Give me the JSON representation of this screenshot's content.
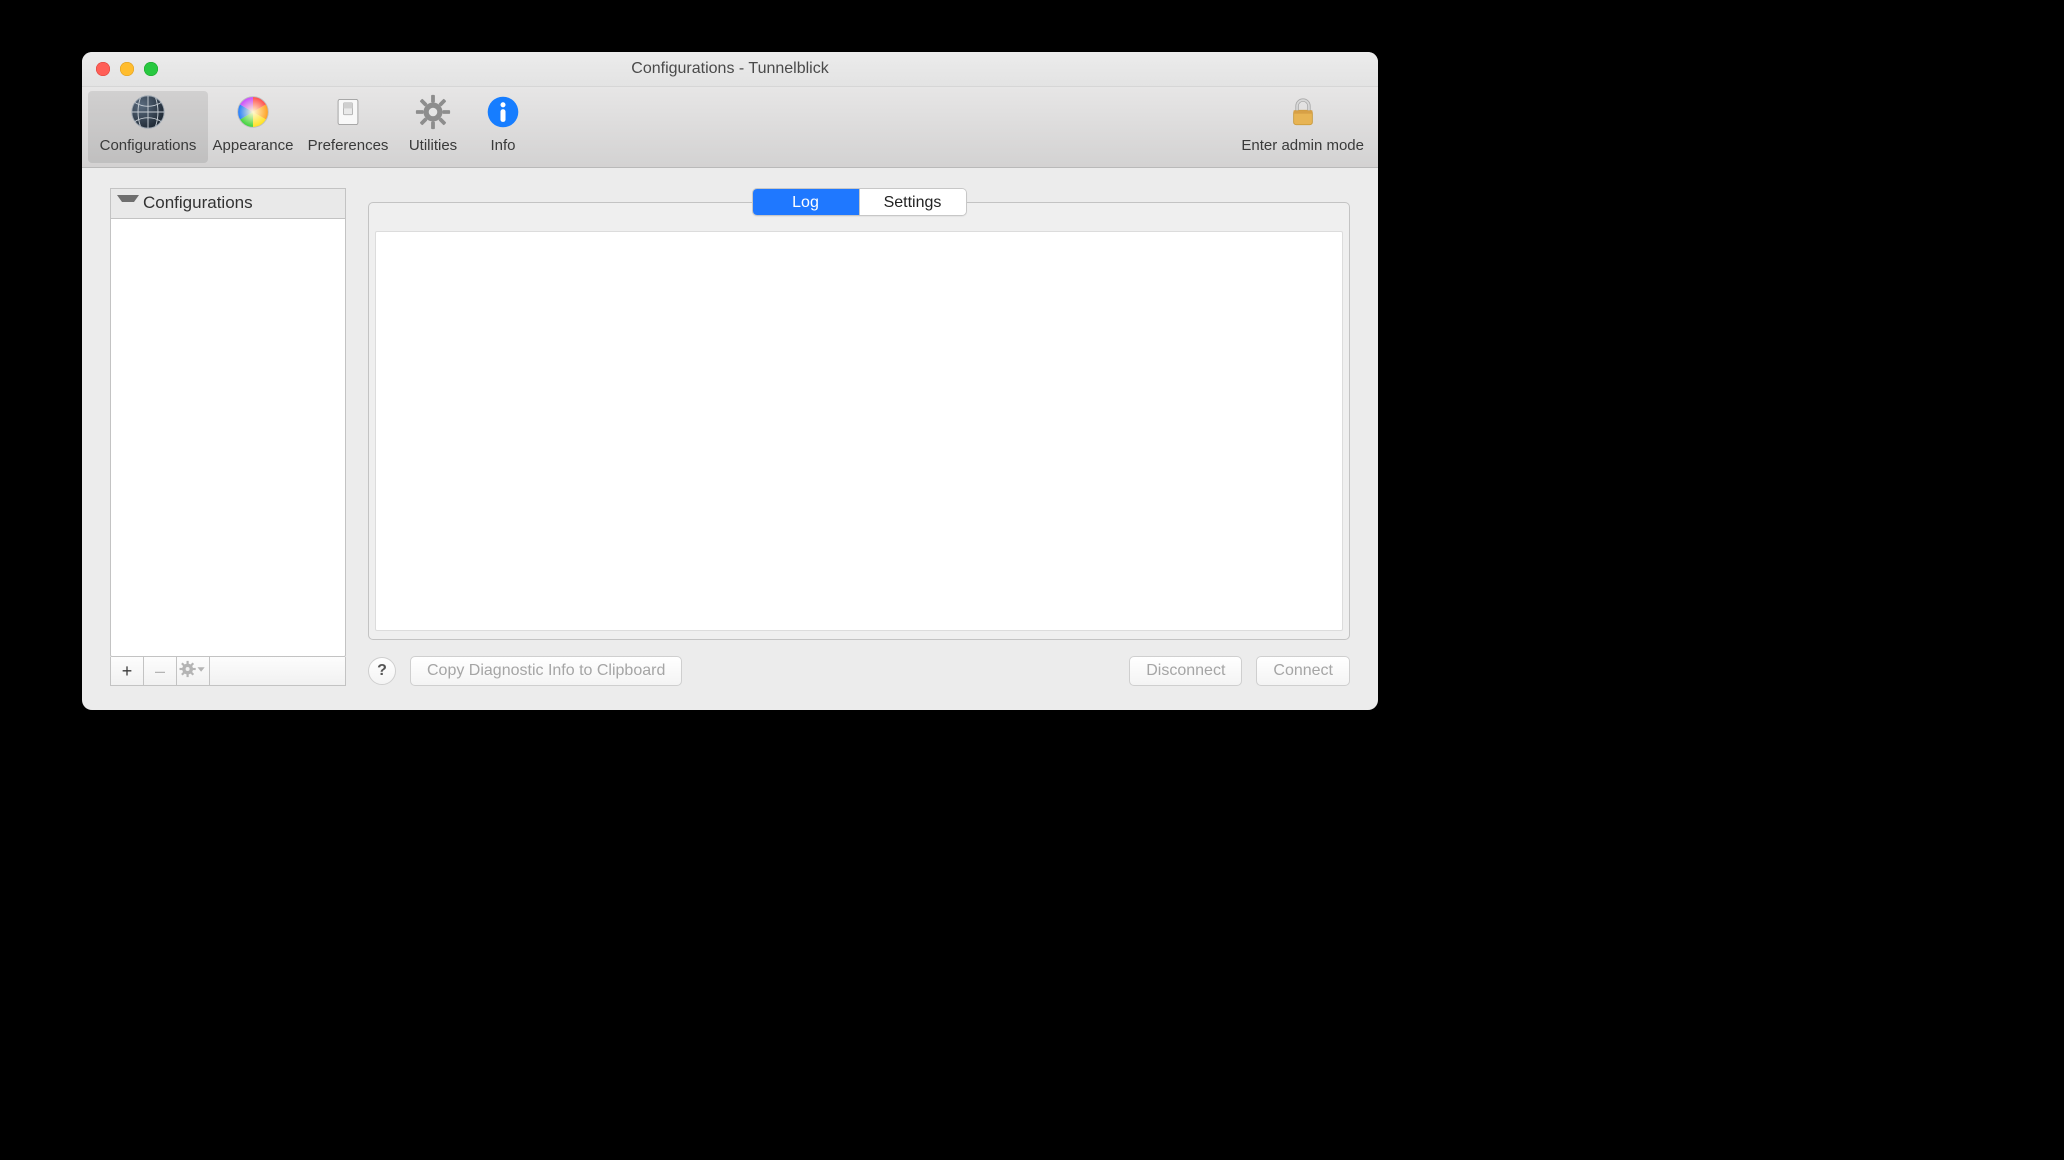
{
  "window": {
    "title": "Configurations - Tunnelblick"
  },
  "toolbar": {
    "items": [
      {
        "label": "Configurations",
        "icon": "network-globe-icon",
        "active": true
      },
      {
        "label": "Appearance",
        "icon": "color-wheel-icon",
        "active": false
      },
      {
        "label": "Preferences",
        "icon": "switch-panel-icon",
        "active": false
      },
      {
        "label": "Utilities",
        "icon": "gear-icon",
        "active": false
      },
      {
        "label": "Info",
        "icon": "info-icon",
        "active": false
      }
    ],
    "admin": {
      "label": "Enter admin mode",
      "icon": "lock-icon"
    }
  },
  "sidebar": {
    "header": "Configurations",
    "expanded": true,
    "items": [],
    "add_tooltip": "+",
    "remove_tooltip": "–"
  },
  "main": {
    "tabs": [
      {
        "label": "Log",
        "active": true
      },
      {
        "label": "Settings",
        "active": false
      }
    ],
    "log_text": ""
  },
  "buttons": {
    "help": "?",
    "copy_diag": "Copy Diagnostic Info to Clipboard",
    "disconnect": "Disconnect",
    "connect": "Connect"
  }
}
